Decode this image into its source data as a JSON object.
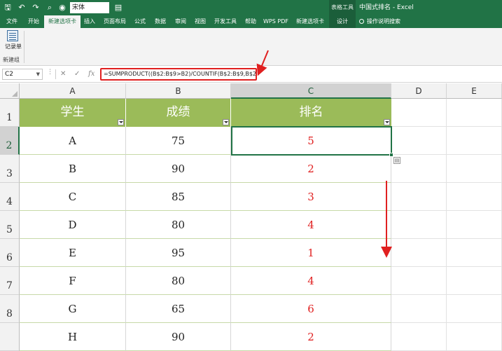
{
  "app": {
    "title": "中国式排名 - Excel",
    "context_tab_group": "表格工具",
    "font_name": "宋体"
  },
  "quick_access": {
    "save_glyph": "🖫",
    "undo_glyph": "↶",
    "redo_glyph": "↷",
    "preview_glyph": "⌕",
    "camera_glyph": "◉",
    "format_glyph": "▤"
  },
  "tabs": [
    {
      "label": "文件"
    },
    {
      "label": "开始"
    },
    {
      "label": "新建选项卡"
    },
    {
      "label": "插入"
    },
    {
      "label": "页面布局"
    },
    {
      "label": "公式"
    },
    {
      "label": "数据"
    },
    {
      "label": "审阅"
    },
    {
      "label": "视图"
    },
    {
      "label": "开发工具"
    },
    {
      "label": "帮助"
    },
    {
      "label": "WPS PDF"
    },
    {
      "label": "新建选项卡"
    },
    {
      "label": "设计"
    }
  ],
  "tell_me": "操作说明搜索",
  "ribbon": {
    "button_label": "记录单",
    "group_label": "新建组"
  },
  "formula_bar": {
    "name_box": "C2",
    "cancel_glyph": "✕",
    "enter_glyph": "✓",
    "fx_glyph": "fx",
    "formula": "=SUMPRODUCT((B$2:B$9>B2)/COUNTIF(B$2:B$9,B$2:B$9))+1"
  },
  "sheet": {
    "columns": [
      "A",
      "B",
      "C",
      "D",
      "E"
    ],
    "row_numbers": [
      "1",
      "2",
      "3",
      "4",
      "5",
      "6",
      "7",
      "8"
    ],
    "headers": [
      "学生",
      "成绩",
      "排名"
    ],
    "rows": [
      {
        "student": "A",
        "score": "75",
        "rank": "5"
      },
      {
        "student": "B",
        "score": "90",
        "rank": "2"
      },
      {
        "student": "C",
        "score": "85",
        "rank": "3"
      },
      {
        "student": "D",
        "score": "80",
        "rank": "4"
      },
      {
        "student": "E",
        "score": "95",
        "rank": "1"
      },
      {
        "student": "F",
        "score": "80",
        "rank": "4"
      },
      {
        "student": "G",
        "score": "65",
        "rank": "6"
      },
      {
        "student": "H",
        "score": "90",
        "rank": "2"
      }
    ],
    "active_cell": "C2"
  },
  "colors": {
    "ribbon_green": "#217346",
    "header_fill": "#9bbb59",
    "rank_text": "#e02020",
    "annotation_red": "#e02020"
  }
}
